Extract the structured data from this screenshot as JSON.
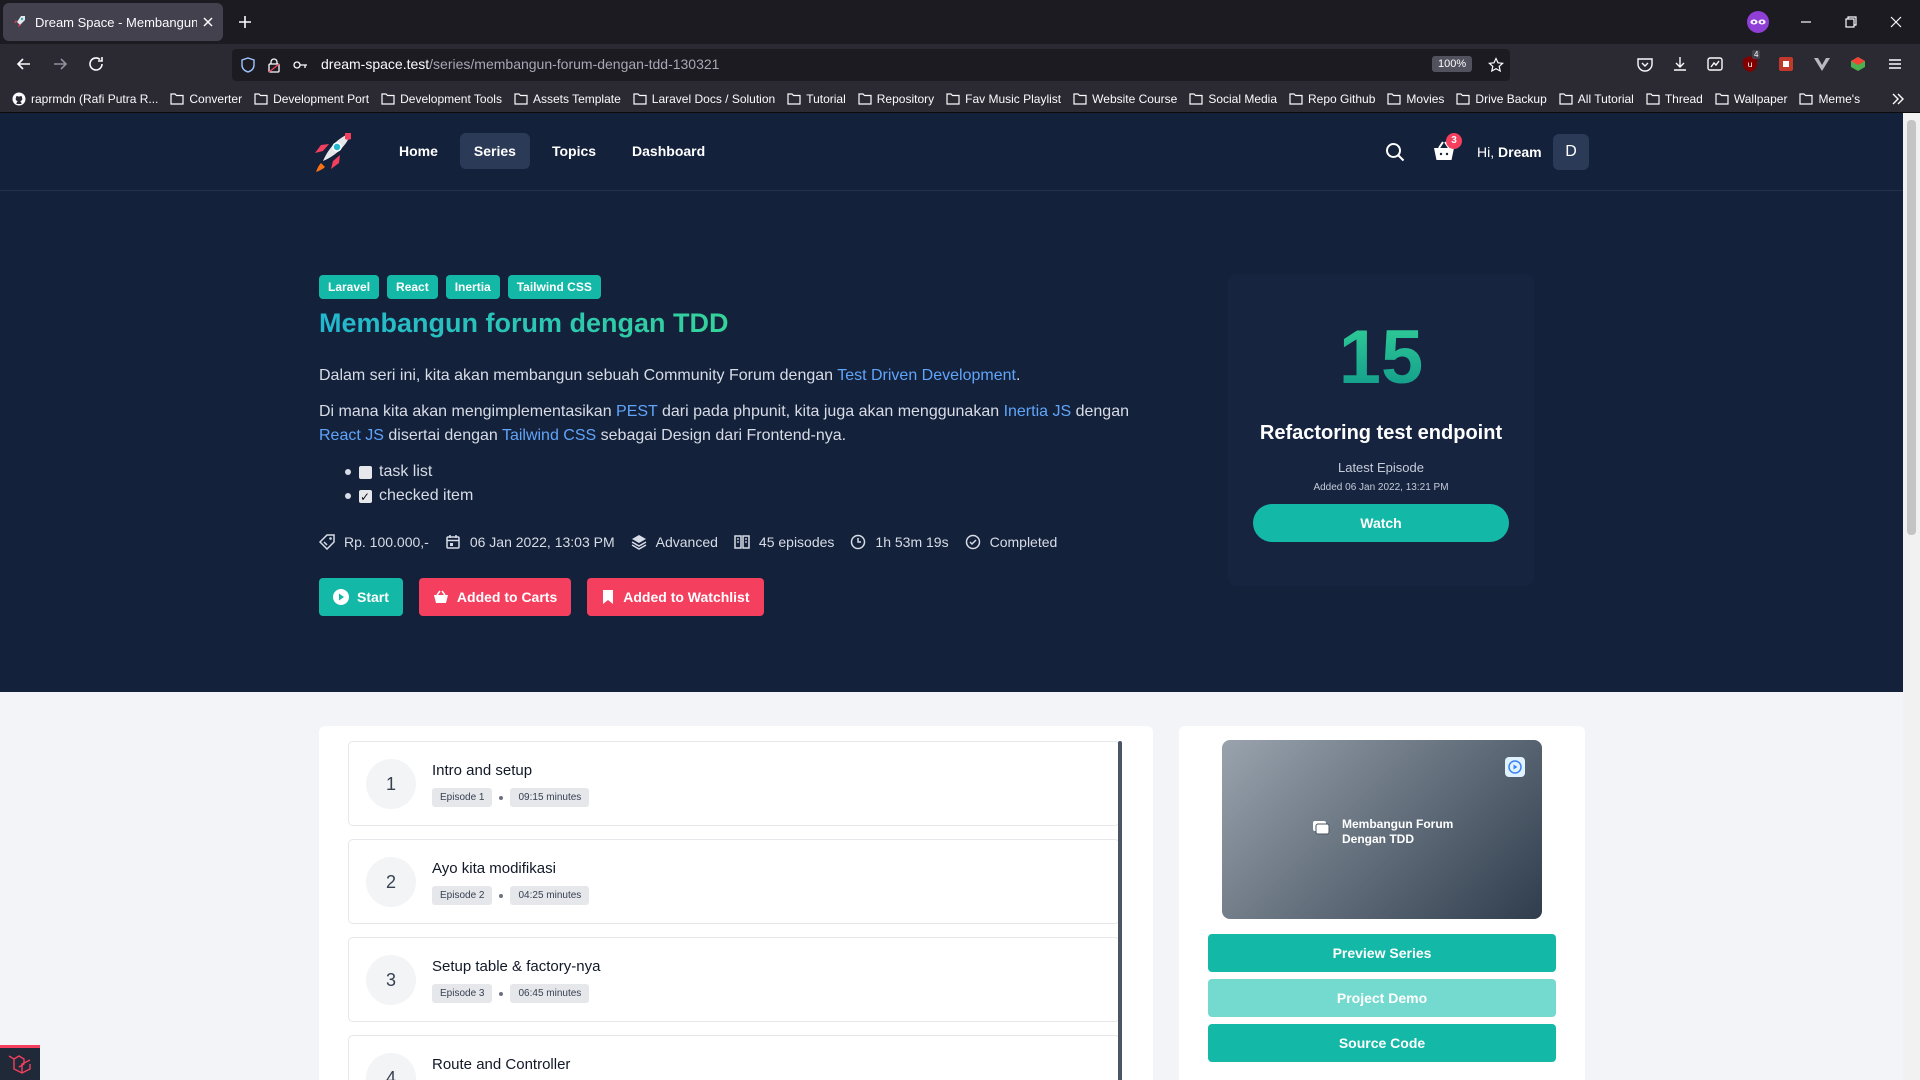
{
  "browser": {
    "tab_title": "Dream Space - Membangun forum dengan TDD",
    "url_host": "dream-space.test",
    "url_path": "/series/membangun-forum-dengan-tdd-130321",
    "zoom": "100%",
    "toolbar_badge": "4",
    "bookmarks": [
      "raprmdn (Rafi Putra R...",
      "Converter",
      "Development Port",
      "Development Tools",
      "Assets Template",
      "Laravel Docs / Solution",
      "Tutorial",
      "Repository",
      "Fav Music Playlist",
      "Website Course",
      "Social Media",
      "Repo Github",
      "Movies",
      "Drive Backup",
      "All Tutorial",
      "Thread",
      "Wallpaper",
      "Meme's"
    ]
  },
  "header": {
    "nav": [
      "Home",
      "Series",
      "Topics",
      "Dashboard"
    ],
    "active_nav": "Series",
    "cart_count": "3",
    "greeting": "Hi,",
    "username": "Dream",
    "avatar_letter": "D"
  },
  "series": {
    "tags": [
      "Laravel",
      "React",
      "Inertia",
      "Tailwind CSS"
    ],
    "title": "Membangun forum dengan TDD",
    "desc1": {
      "before": "Dalam seri ini, kita akan membangun sebuah Community Forum dengan ",
      "link": "Test Driven Development",
      "after": "."
    },
    "desc2": {
      "t1": "Di mana kita akan mengimplementasikan ",
      "l1": "PEST",
      "t2": " dari pada phpunit, kita juga akan menggunakan ",
      "l2": "Inertia JS",
      "t3": " dengan ",
      "l3": "React JS",
      "t4": " disertai dengan ",
      "l4": "Tailwind CSS",
      "t5": " sebagai Design dari Frontend-nya."
    },
    "tasks": [
      {
        "label": "task list",
        "checked": false
      },
      {
        "label": "checked item",
        "checked": true
      }
    ],
    "meta": {
      "price": "Rp. 100.000,-",
      "date": "06 Jan 2022, 13:03 PM",
      "level": "Advanced",
      "episodes": "45 episodes",
      "duration": "1h 53m 19s",
      "status": "Completed"
    },
    "buttons": {
      "start": "Start",
      "cart": "Added to Carts",
      "watchlist": "Added to Watchlist"
    }
  },
  "latest": {
    "number": "15",
    "title": "Refactoring test endpoint",
    "label": "Latest Episode",
    "added": "Added 06 Jan 2022, 13:21 PM",
    "watch": "Watch"
  },
  "episodes": [
    {
      "num": "1",
      "title": "Intro and setup",
      "episode": "Episode 1",
      "duration": "09:15 minutes"
    },
    {
      "num": "2",
      "title": "Ayo kita modifikasi",
      "episode": "Episode 2",
      "duration": "04:25 minutes"
    },
    {
      "num": "3",
      "title": "Setup table & factory-nya",
      "episode": "Episode 3",
      "duration": "06:45 minutes"
    },
    {
      "num": "4",
      "title": "Route and Controller",
      "episode": "",
      "duration": ""
    }
  ],
  "sidebar": {
    "thumb_title": "Membangun Forum Dengan TDD",
    "preview": "Preview Series",
    "demo": "Project Demo",
    "source": "Source Code"
  },
  "colors": {
    "accent": "#14b8a6",
    "danger": "#f43f5e",
    "hero_bg": "#14213b"
  }
}
